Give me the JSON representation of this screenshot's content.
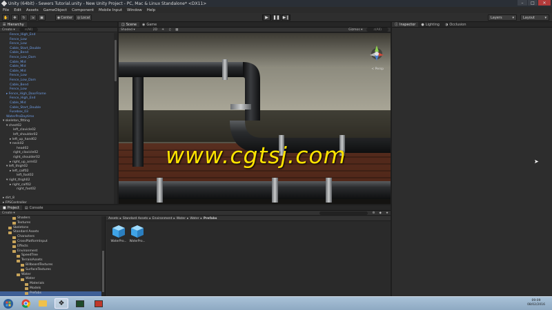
{
  "window": {
    "title": "Unity (64bit) - Sewers Tutorial.unity - New Unity Project - PC, Mac & Linux Standalone* <DX11>"
  },
  "menu": [
    "File",
    "Edit",
    "Assets",
    "GameObject",
    "Component",
    "Mobile Input",
    "Window",
    "Help"
  ],
  "toolbar": {
    "center_label": "Center",
    "local_label": "Local",
    "layers_label": "Layers",
    "layout_label": "Layout"
  },
  "hierarchy": {
    "tab": "Hierarchy",
    "create": "Create",
    "search": "(All)",
    "rows": [
      {
        "text": "Fence_High_End",
        "indent": 2,
        "prefab": true
      },
      {
        "text": "Fence_Low",
        "indent": 2,
        "prefab": true
      },
      {
        "text": "Fence_Low",
        "indent": 2,
        "prefab": true
      },
      {
        "text": "Cable_Start_Double",
        "indent": 2,
        "prefab": true
      },
      {
        "text": "Cable_Bend",
        "indent": 2,
        "prefab": true
      },
      {
        "text": "Fence_Low_Dam",
        "indent": 2,
        "prefab": true
      },
      {
        "text": "Cable_Mid",
        "indent": 2,
        "prefab": true
      },
      {
        "text": "Cable_Mid",
        "indent": 2,
        "prefab": true
      },
      {
        "text": "Cable_Mid",
        "indent": 2,
        "prefab": true
      },
      {
        "text": "Fence_Low",
        "indent": 2,
        "prefab": true
      },
      {
        "text": "Fence_Low_Dam",
        "indent": 2,
        "prefab": true
      },
      {
        "text": "Cable_Bend",
        "indent": 2,
        "prefab": true
      },
      {
        "text": "Fence_Low",
        "indent": 2,
        "prefab": true
      },
      {
        "text": "▸ Fence_High_DoorFrame",
        "indent": 1,
        "prefab": true
      },
      {
        "text": "Fence_High_End",
        "indent": 2,
        "prefab": true
      },
      {
        "text": "Cable_Mid",
        "indent": 2,
        "prefab": true
      },
      {
        "text": "Cable_Start_Double",
        "indent": 2,
        "prefab": true
      },
      {
        "text": "Fusebox_03",
        "indent": 2,
        "prefab": true
      },
      {
        "text": "WaterProDaytime",
        "indent": 1,
        "prefab": true
      },
      {
        "text": "▾ skeleton_fitting",
        "indent": 0,
        "prefab": false
      },
      {
        "text": "▾ chest02",
        "indent": 1,
        "prefab": false
      },
      {
        "text": "left_clavicle02",
        "indent": 3,
        "prefab": false
      },
      {
        "text": "left_shoulder02",
        "indent": 3,
        "prefab": false
      },
      {
        "text": "▸ left_up_hand02",
        "indent": 2,
        "prefab": false
      },
      {
        "text": "▾ neck02",
        "indent": 2,
        "prefab": false
      },
      {
        "text": "head02",
        "indent": 4,
        "prefab": false
      },
      {
        "text": "right_clavicle02",
        "indent": 3,
        "prefab": false
      },
      {
        "text": "right_shoulder02",
        "indent": 3,
        "prefab": false
      },
      {
        "text": "▸ right_up_arm02",
        "indent": 2,
        "prefab": false
      },
      {
        "text": "▾ left_thigh02",
        "indent": 1,
        "prefab": false
      },
      {
        "text": "▸ left_calf02",
        "indent": 2,
        "prefab": false
      },
      {
        "text": "left_foot02",
        "indent": 4,
        "prefab": false
      },
      {
        "text": "▾ right_thigh02",
        "indent": 1,
        "prefab": false
      },
      {
        "text": "▸ right_calf02",
        "indent": 2,
        "prefab": false
      },
      {
        "text": "right_foot02",
        "indent": 4,
        "prefab": false
      },
      {
        "text": "",
        "indent": 0,
        "prefab": false
      },
      {
        "text": "▸ dirt_8",
        "indent": 0,
        "prefab": false
      },
      {
        "text": "▸ FPSController",
        "indent": 0,
        "prefab": false
      },
      {
        "text": "▸ dirt_9",
        "indent": 0,
        "prefab": false
      }
    ]
  },
  "scene": {
    "tab_scene": "Scene",
    "tab_game": "Game",
    "shading": "Shaded",
    "mode_2d": "2D",
    "gizmos": "Gizmos",
    "search": "(All)",
    "persp": "< Persp",
    "watermark": "www.cgtsj.com"
  },
  "inspector": {
    "tab_inspector": "Inspector",
    "tab_lighting": "Lighting",
    "tab_occlusion": "Occlusion"
  },
  "project": {
    "tab_project": "Project",
    "tab_console": "Console",
    "create": "Create",
    "breadcrumb": [
      "Assets",
      "Standard Assets",
      "Environment",
      "Water",
      "Water",
      "Prefabs"
    ],
    "tree": [
      {
        "text": "Shaders",
        "indent": 2
      },
      {
        "text": "Textures",
        "indent": 2
      },
      {
        "text": "Skeletons",
        "indent": 1
      },
      {
        "text": "Standard Assets",
        "indent": 1
      },
      {
        "text": "Characters",
        "indent": 2
      },
      {
        "text": "CrossPlatformInput",
        "indent": 2
      },
      {
        "text": "Effects",
        "indent": 2
      },
      {
        "text": "Environment",
        "indent": 2
      },
      {
        "text": "SpeedTree",
        "indent": 3
      },
      {
        "text": "TerrainAssets",
        "indent": 3
      },
      {
        "text": "BillboardTextures",
        "indent": 4
      },
      {
        "text": "SurfaceTextures",
        "indent": 4
      },
      {
        "text": "Water",
        "indent": 3
      },
      {
        "text": "Water",
        "indent": 4
      },
      {
        "text": "Materials",
        "indent": 5
      },
      {
        "text": "Models",
        "indent": 5
      },
      {
        "text": "Prefabs",
        "indent": 5
      }
    ],
    "assets": [
      {
        "label": "WaterPro..."
      },
      {
        "label": "WaterPro..."
      }
    ]
  },
  "taskbar": {
    "time": "09:09",
    "date": "08/02/2016"
  }
}
